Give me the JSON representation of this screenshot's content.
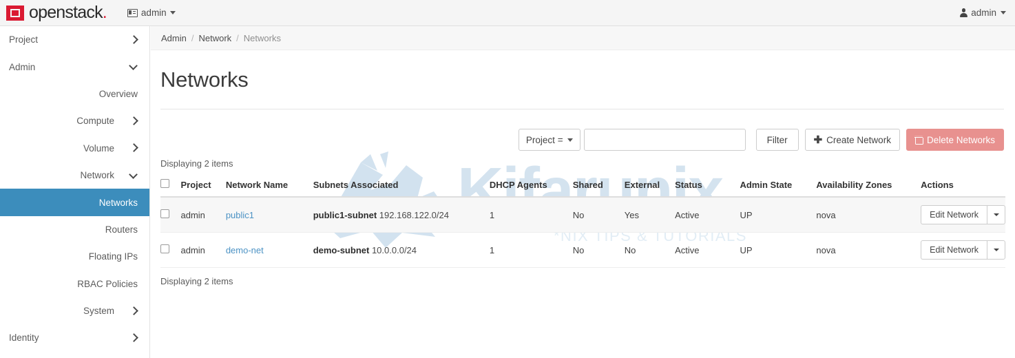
{
  "navbar": {
    "brand_name": "openstack",
    "brand_dot": ".",
    "project_label": "admin",
    "project_icon": "building-icon",
    "user_label": "admin",
    "user_icon": "user-icon"
  },
  "sidebar": {
    "items": [
      {
        "label": "Project",
        "level": 1,
        "arrow": "right",
        "active": false
      },
      {
        "label": "Admin",
        "level": 1,
        "arrow": "down",
        "active": false
      },
      {
        "label": "Overview",
        "level": 2,
        "arrow": "none",
        "active": false
      },
      {
        "label": "Compute",
        "level": 2,
        "arrow": "right",
        "active": false
      },
      {
        "label": "Volume",
        "level": 2,
        "arrow": "right",
        "active": false
      },
      {
        "label": "Network",
        "level": 2,
        "arrow": "down",
        "active": false
      },
      {
        "label": "Networks",
        "level": 3,
        "arrow": "none",
        "active": true
      },
      {
        "label": "Routers",
        "level": 3,
        "arrow": "none",
        "active": false
      },
      {
        "label": "Floating IPs",
        "level": 3,
        "arrow": "none",
        "active": false
      },
      {
        "label": "RBAC Policies",
        "level": 3,
        "arrow": "none",
        "active": false
      },
      {
        "label": "System",
        "level": 2,
        "arrow": "right",
        "active": false
      },
      {
        "label": "Identity",
        "level": 1,
        "arrow": "right",
        "active": false
      }
    ],
    "active_color": "#3c8dbc"
  },
  "breadcrumb": {
    "item1": "Admin",
    "sep1": "/",
    "item2": "Network",
    "sep2": "/",
    "current": "Networks"
  },
  "page": {
    "title": "Networks"
  },
  "toolbar": {
    "filter_type_label": "Project =",
    "filter_placeholder": "",
    "filter_value": "",
    "filter_button": "Filter",
    "create_icon": "plus-icon",
    "create_label": "Create Network",
    "delete_icon": "trash-icon",
    "delete_label": "Delete Networks",
    "delete_color": "#e8918f"
  },
  "table": {
    "count_top": "Displaying 2 items",
    "count_bottom": "Displaying 2 items",
    "headers": [
      "",
      "Project",
      "Network Name",
      "Subnets Associated",
      "DHCP Agents",
      "Shared",
      "External",
      "Status",
      "Admin State",
      "Availability Zones",
      "Actions"
    ],
    "rows": [
      {
        "project": "admin",
        "network_name": "public1",
        "subnet_name": "public1-subnet",
        "subnet_cidr": "192.168.122.0/24",
        "dhcp_agents": "1",
        "shared": "No",
        "external": "Yes",
        "status": "Active",
        "admin_state": "UP",
        "availability_zones": "nova",
        "action_label": "Edit Network"
      },
      {
        "project": "admin",
        "network_name": "demo-net",
        "subnet_name": "demo-subnet",
        "subnet_cidr": "10.0.0.0/24",
        "dhcp_agents": "1",
        "shared": "No",
        "external": "No",
        "status": "Active",
        "admin_state": "UP",
        "availability_zones": "nova",
        "action_label": "Edit Network"
      }
    ]
  },
  "watermark": {
    "text": "Kifarunix",
    "subtitle": "*NIX TIPS & TUTORIALS",
    "color": "#d4e3ef"
  }
}
